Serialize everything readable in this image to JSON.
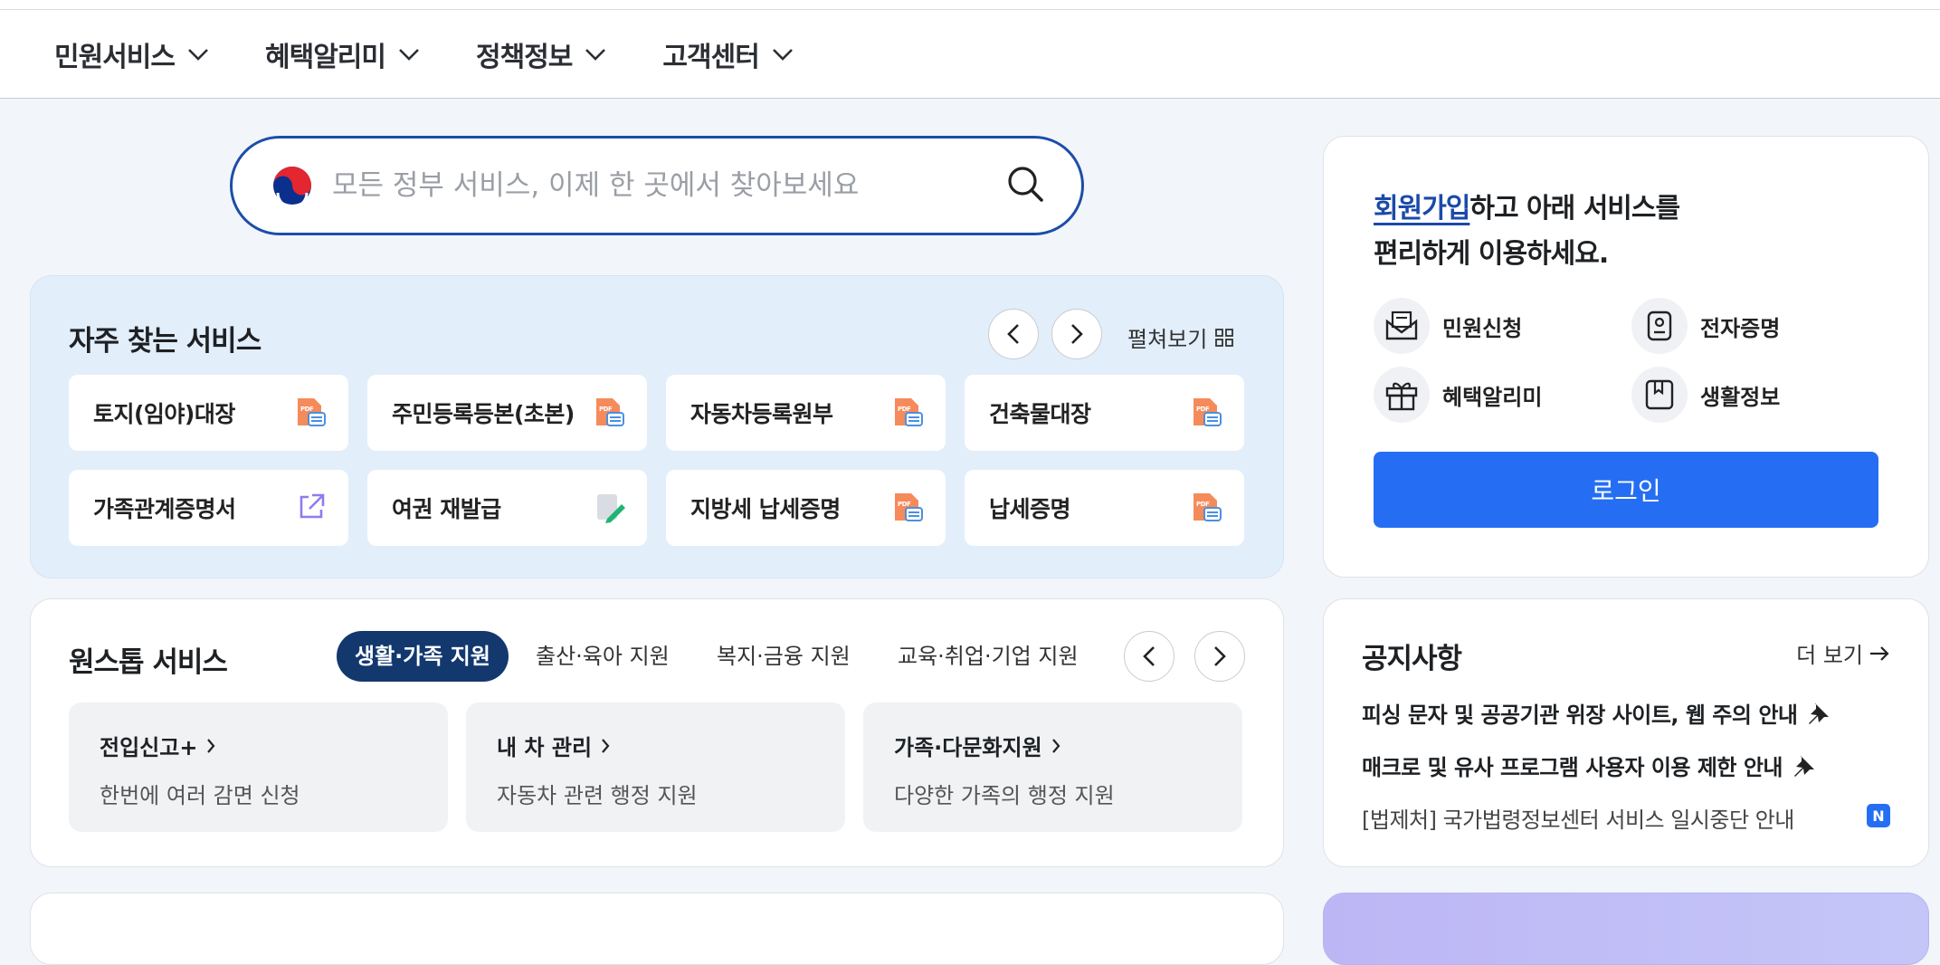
{
  "nav": {
    "items": [
      {
        "label": "민원서비스"
      },
      {
        "label": "혜택알리미"
      },
      {
        "label": "정책정보"
      },
      {
        "label": "고객센터"
      }
    ]
  },
  "search": {
    "placeholder": "모든 정부 서비스, 이제 한 곳에서 찾아보세요"
  },
  "frequent": {
    "title": "자주 찾는 서비스",
    "expand_label": "펼쳐보기",
    "items": [
      {
        "label": "토지(임야)대장",
        "icon": "pdf-doc-icon"
      },
      {
        "label": "주민등록등본(초본)",
        "icon": "pdf-doc-icon"
      },
      {
        "label": "자동차등록원부",
        "icon": "pdf-doc-icon"
      },
      {
        "label": "건축물대장",
        "icon": "pdf-doc-icon"
      },
      {
        "label": "가족관계증명서",
        "icon": "external-link-icon"
      },
      {
        "label": "여권 재발급",
        "icon": "edit-doc-icon"
      },
      {
        "label": "지방세 납세증명",
        "icon": "pdf-doc-icon"
      },
      {
        "label": "납세증명",
        "icon": "pdf-doc-icon"
      }
    ]
  },
  "onestop": {
    "title": "원스톱 서비스",
    "tabs": [
      {
        "label": "생활·가족 지원",
        "active": true
      },
      {
        "label": "출산·육아 지원"
      },
      {
        "label": "복지·금융 지원"
      },
      {
        "label": "교육·취업·기업 지원"
      }
    ],
    "cards": [
      {
        "title": "전입신고+",
        "desc": "한번에 여러 감면 신청"
      },
      {
        "title": "내 차 관리",
        "desc": "자동차 관련 행정 지원"
      },
      {
        "title": "가족·다문화지원",
        "desc": "다양한 가족의 행정 지원"
      }
    ]
  },
  "login": {
    "signup_link": "회원가입",
    "msg_rest": "하고 아래 서비스를",
    "msg_line2": "편리하게 이용하세요.",
    "quick": [
      {
        "label": "민원신청",
        "icon": "envelope-doc-icon"
      },
      {
        "label": "전자증명",
        "icon": "id-badge-icon"
      },
      {
        "label": "혜택알리미",
        "icon": "gift-icon"
      },
      {
        "label": "생활정보",
        "icon": "bookmark-icon"
      }
    ],
    "button_label": "로그인"
  },
  "notice": {
    "title": "공지사항",
    "more_label": "더 보기",
    "items": [
      {
        "text": "피싱 문자 및 공공기관 위장 사이트, 웹 주의 안내",
        "pinned": true
      },
      {
        "text": "매크로 및 유사 프로그램 사용자 이용 제한 안내",
        "pinned": true
      },
      {
        "text": "[법제처] 국가법령정보센터 서비스 일시중단 안내",
        "badge": "N"
      }
    ]
  },
  "colors": {
    "primary": "#256ef4",
    "navy": "#12386e",
    "link": "#1b4aa8",
    "bg": "#f2f5fa"
  }
}
